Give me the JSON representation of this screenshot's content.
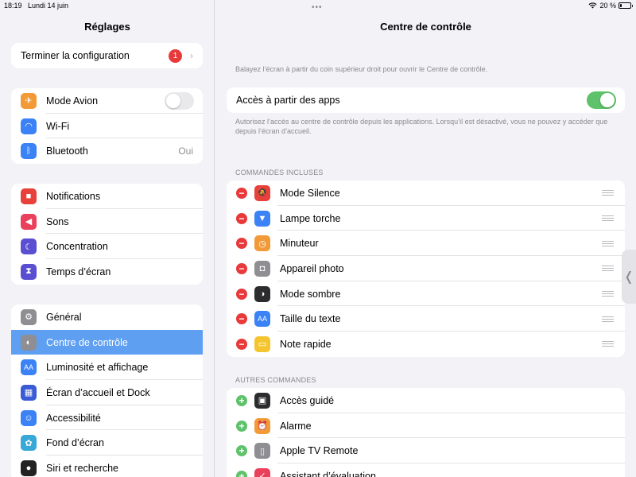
{
  "statusbar": {
    "time": "18:19",
    "date": "Lundi 14 juin",
    "battery": "20 %",
    "battery_level": 0.2
  },
  "sidebar": {
    "title": "Réglages",
    "setup": {
      "label": "Terminer la configuration",
      "badge": "1"
    },
    "group1": [
      {
        "label": "Mode Avion",
        "icon": "airplane-icon",
        "color": "#f29a38",
        "toggle": false
      },
      {
        "label": "Wi-Fi",
        "icon": "wifi-icon",
        "color": "#3a82f6"
      },
      {
        "label": "Bluetooth",
        "icon": "bluetooth-icon",
        "color": "#3a82f6",
        "value": "Oui"
      }
    ],
    "group2": [
      {
        "label": "Notifications",
        "icon": "notifications-icon",
        "color": "#e8413c"
      },
      {
        "label": "Sons",
        "icon": "speaker-icon",
        "color": "#e9405c"
      },
      {
        "label": "Concentration",
        "icon": "moon-icon",
        "color": "#5a4fd1"
      },
      {
        "label": "Temps d’écran",
        "icon": "hourglass-icon",
        "color": "#5a4fd1"
      }
    ],
    "group3": [
      {
        "label": "Général",
        "icon": "gear-icon",
        "color": "#8e8e93"
      },
      {
        "label": "Centre de contrôle",
        "icon": "switches-icon",
        "color": "#8e8e93",
        "selected": true
      },
      {
        "label": "Luminosité et affichage",
        "icon": "text-size-icon",
        "color": "#3a82f6"
      },
      {
        "label": "Écran d’accueil et Dock",
        "icon": "home-grid-icon",
        "color": "#3a5bd6"
      },
      {
        "label": "Accessibilité",
        "icon": "accessibility-icon",
        "color": "#3a82f6"
      },
      {
        "label": "Fond d’écran",
        "icon": "flower-icon",
        "color": "#38a8d8"
      },
      {
        "label": "Siri et recherche",
        "icon": "siri-icon",
        "color": "#222222"
      }
    ]
  },
  "main": {
    "title": "Centre de contrôle",
    "hint_top": "Balayez l’écran à partir du coin supérieur droit pour ouvrir le Centre de contrôle.",
    "apps_access": {
      "label": "Accès à partir des apps",
      "toggle": true
    },
    "hint_apps": "Autorisez l’accès au centre de contrôle depuis les applications. Lorsqu’il est désactivé, vous ne pouvez y accéder que depuis l’écran d’accueil.",
    "included_header": "COMMANDES INCLUSES",
    "included": [
      {
        "label": "Mode Silence",
        "icon": "bell-slash-icon",
        "color": "#e8413c"
      },
      {
        "label": "Lampe torche",
        "icon": "flashlight-icon",
        "color": "#3a82f6"
      },
      {
        "label": "Minuteur",
        "icon": "timer-icon",
        "color": "#f29a38"
      },
      {
        "label": "Appareil photo",
        "icon": "camera-icon",
        "color": "#8e8e93"
      },
      {
        "label": "Mode sombre",
        "icon": "dark-mode-icon",
        "color": "#2c2c2e"
      },
      {
        "label": "Taille du texte",
        "icon": "text-size-icon",
        "color": "#3a82f6"
      },
      {
        "label": "Note rapide",
        "icon": "quick-note-icon",
        "color": "#f5c531"
      }
    ],
    "other_header": "AUTRES COMMANDES",
    "other": [
      {
        "label": "Accès guidé",
        "icon": "lock-icon",
        "color": "#2c2c2e"
      },
      {
        "label": "Alarme",
        "icon": "alarm-icon",
        "color": "#f29a38"
      },
      {
        "label": "Apple TV Remote",
        "icon": "remote-icon",
        "color": "#8e8e93"
      },
      {
        "label": "Assistant d’évaluation",
        "icon": "assessment-icon",
        "color": "#e9405c"
      }
    ]
  }
}
